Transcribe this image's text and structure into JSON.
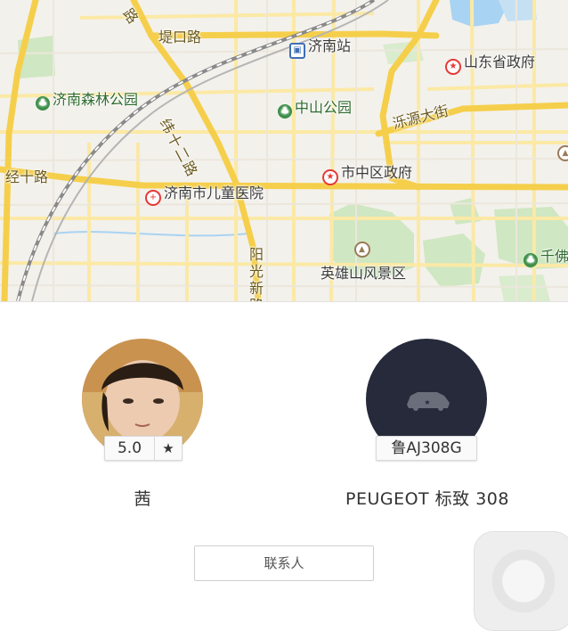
{
  "map": {
    "roads": {
      "jingshi_road": "经十路",
      "tikou_road": "堤口路",
      "wei_shi_er_road": "纬十二路",
      "luoyuan_street": "泺源大街",
      "yangguang_new_road": "阳光新路",
      "top_partial": "路"
    },
    "places": [
      {
        "label": "济南站",
        "icon": "train-station-icon"
      },
      {
        "label": "山东省政府",
        "icon": "government-icon"
      },
      {
        "label": "济南森林公园",
        "icon": "park-icon"
      },
      {
        "label": "中山公园",
        "icon": "park-icon"
      },
      {
        "label": "市中区政府",
        "icon": "government-icon"
      },
      {
        "label": "济南市儿童医院",
        "icon": "hospital-icon"
      },
      {
        "label": "英雄山风景区",
        "icon": "scenic-icon"
      },
      {
        "label": "千佛",
        "icon": "park-icon"
      }
    ]
  },
  "driver": {
    "rating": "5.0",
    "rating_icon": "star-icon",
    "name": "茜"
  },
  "car": {
    "plate": "鲁AJ308G",
    "model": "PEUGEOT 标致 308",
    "icon": "car-icon"
  },
  "actions": {
    "contact_label": "联系人"
  },
  "colors": {
    "main_road": "#f5cf4b",
    "minor_road": "#fbe9a5",
    "green_area": "#cfe7c2",
    "water": "#a9d3f2",
    "car_avatar_bg": "#262a3a"
  }
}
